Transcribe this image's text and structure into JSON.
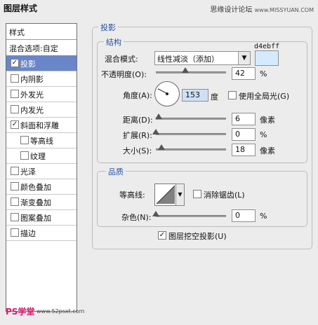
{
  "window": {
    "title": "图层样式"
  },
  "watermark": {
    "text": "思缘设计论坛",
    "url": "www.MISSYUAN.COM"
  },
  "styles_panel": {
    "header": "样式",
    "items": [
      {
        "label": "混合选项:自定",
        "checkbox": false,
        "checked": false,
        "selected": false,
        "indent": false
      },
      {
        "label": "投影",
        "checkbox": true,
        "checked": true,
        "selected": true,
        "indent": false
      },
      {
        "label": "内阴影",
        "checkbox": true,
        "checked": false,
        "selected": false,
        "indent": false
      },
      {
        "label": "外发光",
        "checkbox": true,
        "checked": false,
        "selected": false,
        "indent": false
      },
      {
        "label": "内发光",
        "checkbox": true,
        "checked": false,
        "selected": false,
        "indent": false
      },
      {
        "label": "斜面和浮雕",
        "checkbox": true,
        "checked": true,
        "selected": false,
        "indent": false
      },
      {
        "label": "等高线",
        "checkbox": true,
        "checked": false,
        "selected": false,
        "indent": true
      },
      {
        "label": "纹理",
        "checkbox": true,
        "checked": false,
        "selected": false,
        "indent": true
      },
      {
        "label": "光泽",
        "checkbox": true,
        "checked": false,
        "selected": false,
        "indent": false
      },
      {
        "label": "颜色叠加",
        "checkbox": true,
        "checked": false,
        "selected": false,
        "indent": false
      },
      {
        "label": "渐变叠加",
        "checkbox": true,
        "checked": false,
        "selected": false,
        "indent": false
      },
      {
        "label": "图案叠加",
        "checkbox": true,
        "checked": false,
        "selected": false,
        "indent": false
      },
      {
        "label": "描边",
        "checkbox": true,
        "checked": false,
        "selected": false,
        "indent": false
      }
    ]
  },
  "drop_shadow": {
    "section_title": "投影",
    "structure": {
      "title": "结构",
      "blend_mode_label": "混合模式:",
      "blend_mode_value": "线性减淡（添加）",
      "color_hex": "d4ebff",
      "color": "#d4ebff",
      "opacity_label": "不透明度(O):",
      "opacity_value": "42",
      "opacity_unit": "%",
      "opacity_fraction": 0.42,
      "angle_label": "角度(A):",
      "angle_value": "153",
      "angle_unit": "度",
      "global_light_label": "使用全局光(G)",
      "global_light_checked": false,
      "distance_label": "距离(D):",
      "distance_value": "6",
      "distance_unit": "像素",
      "distance_fraction": 0.04,
      "spread_label": "扩展(R):",
      "spread_value": "0",
      "spread_unit": "%",
      "spread_fraction": 0.0,
      "size_label": "大小(S):",
      "size_value": "18",
      "size_unit": "像素",
      "size_fraction": 0.08
    },
    "quality": {
      "title": "品质",
      "contour_label": "等高线:",
      "antialias_label": "消除锯齿(L)",
      "antialias_checked": false,
      "noise_label": "杂色(N):",
      "noise_value": "0",
      "noise_unit": "%",
      "noise_fraction": 0.0
    },
    "knockout_label": "图层挖空投影(U)",
    "knockout_checked": true
  },
  "footer": {
    "logo": "PS学堂",
    "site": "www.52psxt.com"
  }
}
